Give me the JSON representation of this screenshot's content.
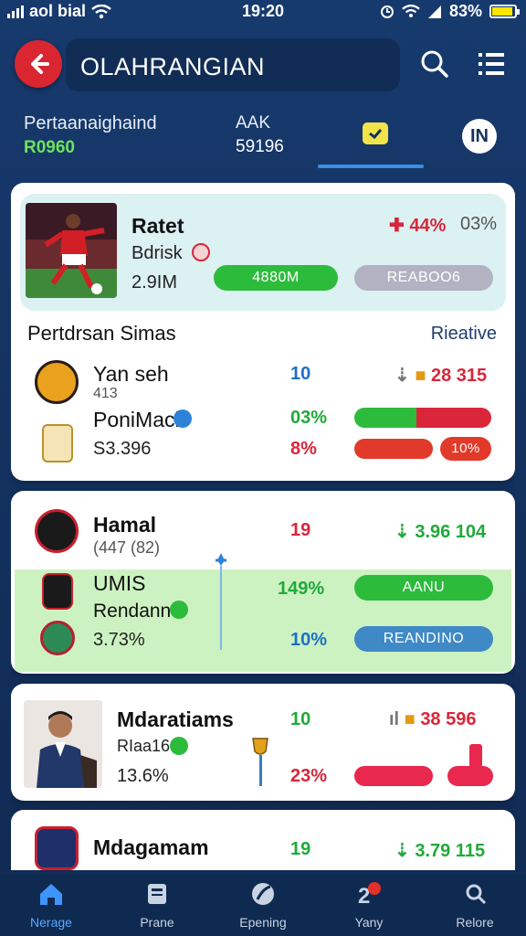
{
  "status": {
    "carrier": "aol bial",
    "time": "19:20",
    "battery": "83%",
    "battery_level": 0.83
  },
  "header": {
    "title": "OLAHRANGIAN"
  },
  "tabs": [
    {
      "line1": "Pertaanaighaind",
      "line2": "R0960"
    },
    {
      "line1": "AAK",
      "line2": "59196"
    },
    {
      "line1": "",
      "line2": ""
    },
    {
      "line1": "IN",
      "line2": ""
    }
  ],
  "featured": {
    "name": "Ratet",
    "subtitle": "Bdrisk",
    "value": "2.9IM",
    "change": "44%",
    "change2": "03%",
    "btn_primary": "4880M",
    "btn_secondary": "REABOO6"
  },
  "section": {
    "title": "Pertdrsan Simas",
    "link": "Rieative"
  },
  "rows1": [
    {
      "name": "Yan seh",
      "sub": "413",
      "num": "10",
      "extra": "28 315"
    },
    {
      "name": "PoniMacl",
      "num": "03%"
    },
    {
      "name": "S3.396",
      "num": "8%",
      "bar": "10%"
    }
  ],
  "card2": {
    "name": "Hamal",
    "sub": "(447 (82)",
    "num": "19",
    "extra": "3.96 104",
    "rows": [
      {
        "name": "UMIS",
        "num": "149%",
        "btn": "AANU"
      },
      {
        "name": "Rendann",
        "num": "10%",
        "btn": "REANDINO"
      },
      {
        "name": "3.73%"
      }
    ]
  },
  "card3": {
    "name": "Mdaratiams",
    "sub": "RIaa16",
    "value": "13.6%",
    "num": "10",
    "num2": "23%",
    "extra": "38 596"
  },
  "card4": {
    "name": "Mdagamam",
    "num": "19",
    "extra": "3.79 115"
  },
  "nav": [
    {
      "label": "Nerage",
      "icon": "home-icon",
      "active": true
    },
    {
      "label": "Prane",
      "icon": "news-icon"
    },
    {
      "label": "Epening",
      "icon": "ball-icon"
    },
    {
      "label": "Yany",
      "icon": "notification-icon"
    },
    {
      "label": "Relore",
      "icon": "profile-icon"
    }
  ],
  "colors": {
    "accent": "#3a8ee6",
    "red": "#d9263a",
    "green": "#2dbb3c",
    "header_bg": "#13325f"
  }
}
